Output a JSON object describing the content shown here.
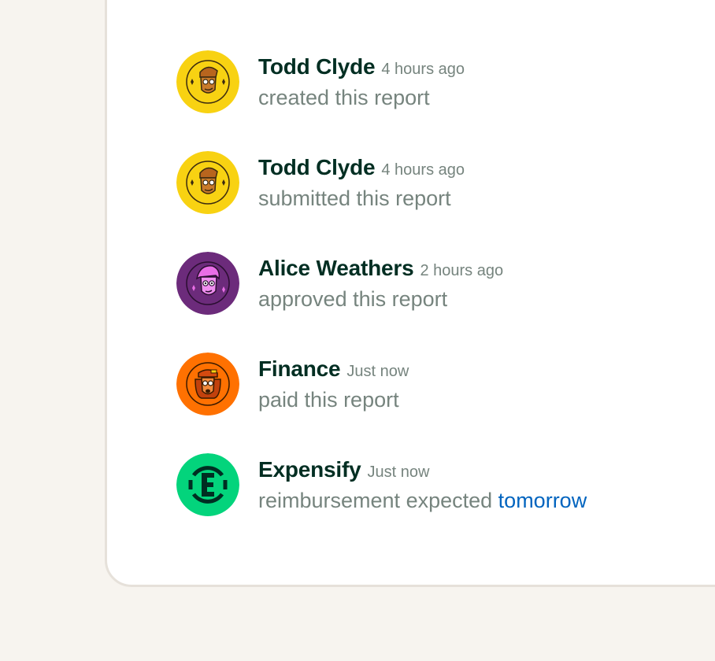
{
  "colors": {
    "page_background": "#f7f4ef",
    "card_background": "#ffffff",
    "name_text": "#002e22",
    "muted_text": "#76847e",
    "link": "#0164bf",
    "avatar_yellow": "#f8d212",
    "avatar_purple": "#6c2b7b",
    "avatar_orange": "#ff7101",
    "avatar_green": "#03d47c"
  },
  "activity": [
    {
      "name": "Todd Clyde",
      "time": "4 hours ago",
      "action": "created this report",
      "avatar_icon": "todd-clyde-avatar-icon"
    },
    {
      "name": "Todd Clyde",
      "time": "4 hours ago",
      "action": "submitted this report",
      "avatar_icon": "todd-clyde-avatar-icon"
    },
    {
      "name": "Alice Weathers",
      "time": "2 hours ago",
      "action": "approved this report",
      "avatar_icon": "alice-weathers-avatar-icon"
    },
    {
      "name": "Finance",
      "time": "Just now",
      "action": "paid this report",
      "avatar_icon": "finance-avatar-icon"
    },
    {
      "name": "Expensify",
      "time": "Just now",
      "action": "reimbursement expected",
      "action_link": "tomorrow",
      "avatar_icon": "expensify-logo-icon"
    }
  ]
}
